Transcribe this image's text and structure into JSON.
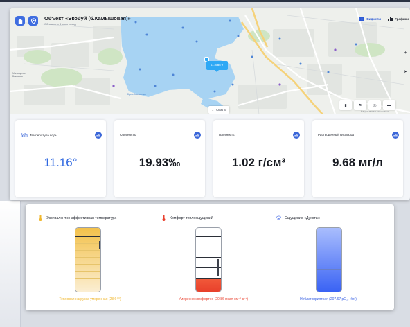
{
  "header": {
    "title": "Объект «Экобуй (б.Камышовая)»",
    "subtitle": "Обновлено 4 часа назад",
    "widgets_label": "Виджеты",
    "charts_label": "Графики"
  },
  "map": {
    "popup_text": "11.16 мг / л",
    "hide_label": "Скрыть",
    "lake_label": "Бухта Камышовая",
    "city_label": "Маласирная\nВакашиза",
    "attribution": "© Яндекс Условия использования"
  },
  "metrics": [
    {
      "label": "Температура воды",
      "value": "11.16°"
    },
    {
      "label": "Соленость",
      "value": "19.93‰"
    },
    {
      "label": "Плотность",
      "value": "1.02 г/см³"
    },
    {
      "label": "Растворенный кислород",
      "value": "9.68 мг/л"
    }
  ],
  "gauges": [
    {
      "title": "Эквивалентно-эффективная температура",
      "caption": "Тепловая нагрузка умеренная (28.64°)",
      "caption_color": "#f0b72d",
      "fill_color_top": "#f3c14a",
      "fill_color_bottom": "#fbeed2",
      "fill_fraction": 1.0
    },
    {
      "title": "Комфорт теплоощущений",
      "caption": "Умеренно комфортно (20.86 мкал см⁻² с⁻¹)",
      "caption_color": "#e9402e",
      "fill_color_top": "#f25b3b",
      "fill_color_bottom": "#e8402b",
      "fill_fraction": 0.22
    },
    {
      "title": "Ощущение «Духоты»",
      "caption": "Неблагоприятная (207.67 pO₂, г/м³)",
      "caption_color": "#3b63e4",
      "fill_color_top": "#a9bdfd",
      "fill_color_bottom": "#3a63f4",
      "fill_fraction": 1.0
    }
  ],
  "colors": {
    "accent": "#3f6de0",
    "lake": "#a7d3f3",
    "popup": "#2ea8f5"
  },
  "icons": {
    "home": "home-icon",
    "location": "location-pin-icon",
    "widgets": "grid-icon",
    "charts": "bar-chart-icon",
    "metric_action": "chart-icon",
    "water_temp": "waves-icon",
    "thermometer": "thermometer-icon",
    "cloud": "cloud-rain-icon"
  }
}
